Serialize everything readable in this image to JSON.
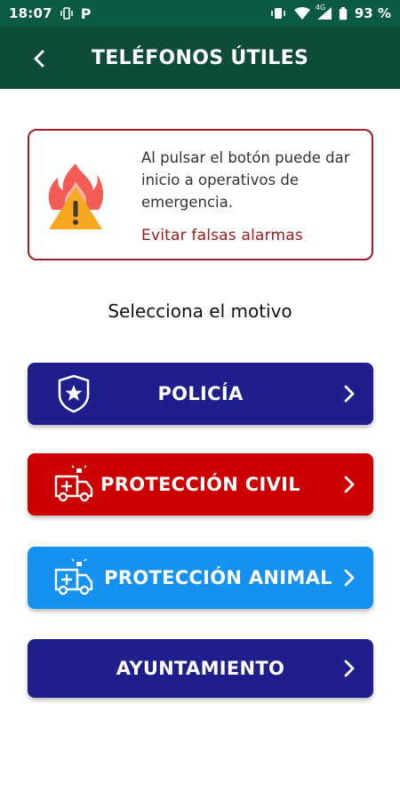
{
  "status_bar": {
    "time": "18:07",
    "p_label": "P",
    "network": "4G",
    "battery": "93 %"
  },
  "header": {
    "title": "TELÉFONOS ÚTILES",
    "back_icon": "chevron-left-icon"
  },
  "warning_card": {
    "icon": "fire-warning-icon",
    "message": "Al pulsar el botón puede dar inicio a operativos de emergencia.",
    "link": "Evitar falsas alarmas"
  },
  "section_title": "Selecciona el motivo",
  "buttons": [
    {
      "label": "POLICÍA",
      "icon": "police-badge-icon",
      "color": "#1e1f8c"
    },
    {
      "label": "PROTECCIÓN CIVIL",
      "icon": "ambulance-icon",
      "color": "#cc0000"
    },
    {
      "label": "PROTECCIÓN ANIMAL",
      "icon": "ambulance-icon",
      "color": "#1592f0"
    },
    {
      "label": "AYUNTAMIENTO",
      "icon": "",
      "color": "#1e1f8c"
    }
  ],
  "colors": {
    "status_bar": "#0b5a43",
    "app_bar": "#0e4b39",
    "warning_border": "#9e1d27",
    "link": "#9a1a1a"
  }
}
